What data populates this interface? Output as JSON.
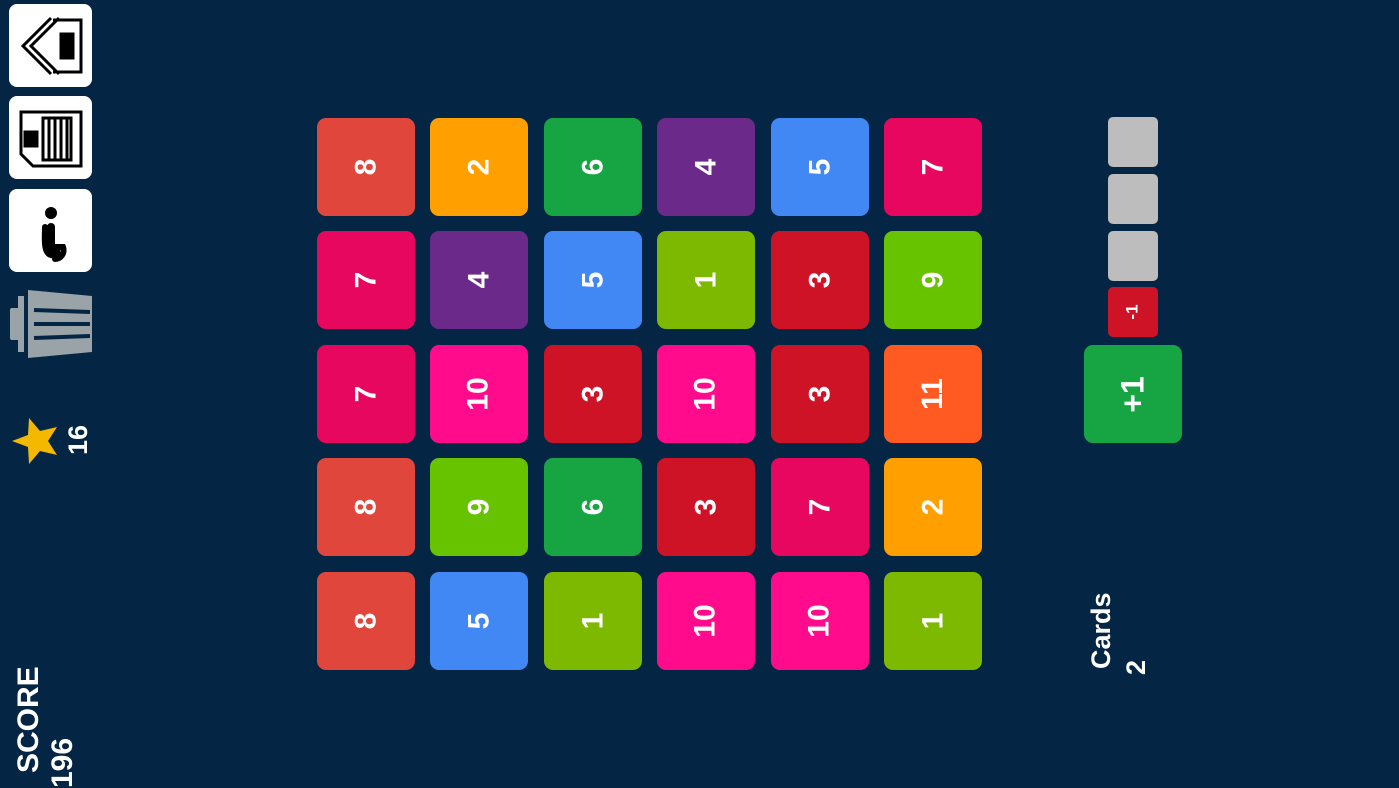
{
  "sidebar": {
    "buttons": [
      {
        "name": "home",
        "icon": "home-back-icon"
      },
      {
        "name": "save",
        "icon": "save-disk-icon"
      },
      {
        "name": "info",
        "icon": "info-icon"
      }
    ],
    "trash_icon": "trash-icon",
    "stars": {
      "icon": "star-icon",
      "count": "16"
    }
  },
  "score": {
    "label": "SCORE",
    "value": "196"
  },
  "board": {
    "rows": [
      [
        {
          "v": "8",
          "c": "#e0463b"
        },
        {
          "v": "2",
          "c": "#ff9f00"
        },
        {
          "v": "6",
          "c": "#16a542"
        },
        {
          "v": "4",
          "c": "#6b2a8a"
        },
        {
          "v": "5",
          "c": "#4288f4"
        },
        {
          "v": "7",
          "c": "#e8075f"
        }
      ],
      [
        {
          "v": "7",
          "c": "#e8075f"
        },
        {
          "v": "4",
          "c": "#6b2a8a"
        },
        {
          "v": "5",
          "c": "#4288f4"
        },
        {
          "v": "1",
          "c": "#7cb900"
        },
        {
          "v": "3",
          "c": "#cf1327"
        },
        {
          "v": "9",
          "c": "#67c200"
        }
      ],
      [
        {
          "v": "7",
          "c": "#e8075f"
        },
        {
          "v": "10",
          "c": "#ff0b8c"
        },
        {
          "v": "3",
          "c": "#cf1327"
        },
        {
          "v": "10",
          "c": "#ff0b8c"
        },
        {
          "v": "3",
          "c": "#cf1327"
        },
        {
          "v": "11",
          "c": "#ff5a21"
        }
      ],
      [
        {
          "v": "8",
          "c": "#e0463b"
        },
        {
          "v": "9",
          "c": "#67c200"
        },
        {
          "v": "6",
          "c": "#16a542"
        },
        {
          "v": "3",
          "c": "#cf1327"
        },
        {
          "v": "7",
          "c": "#e8075f"
        },
        {
          "v": "2",
          "c": "#ff9f00"
        }
      ],
      [
        {
          "v": "8",
          "c": "#e0463b"
        },
        {
          "v": "5",
          "c": "#4288f4"
        },
        {
          "v": "1",
          "c": "#7cb900"
        },
        {
          "v": "10",
          "c": "#ff0b8c"
        },
        {
          "v": "10",
          "c": "#ff0b8c"
        },
        {
          "v": "1",
          "c": "#7cb900"
        }
      ]
    ]
  },
  "side_panel": {
    "slots_empty": 3,
    "minus_label": "-1",
    "plus_label": "+1",
    "cards_label": "Cards",
    "cards_value": "2"
  },
  "colors": {
    "background": "#042544",
    "slot": "#bdbdbd",
    "minus": "#cf1327",
    "plus": "#16a542",
    "star": "#f5b800"
  }
}
